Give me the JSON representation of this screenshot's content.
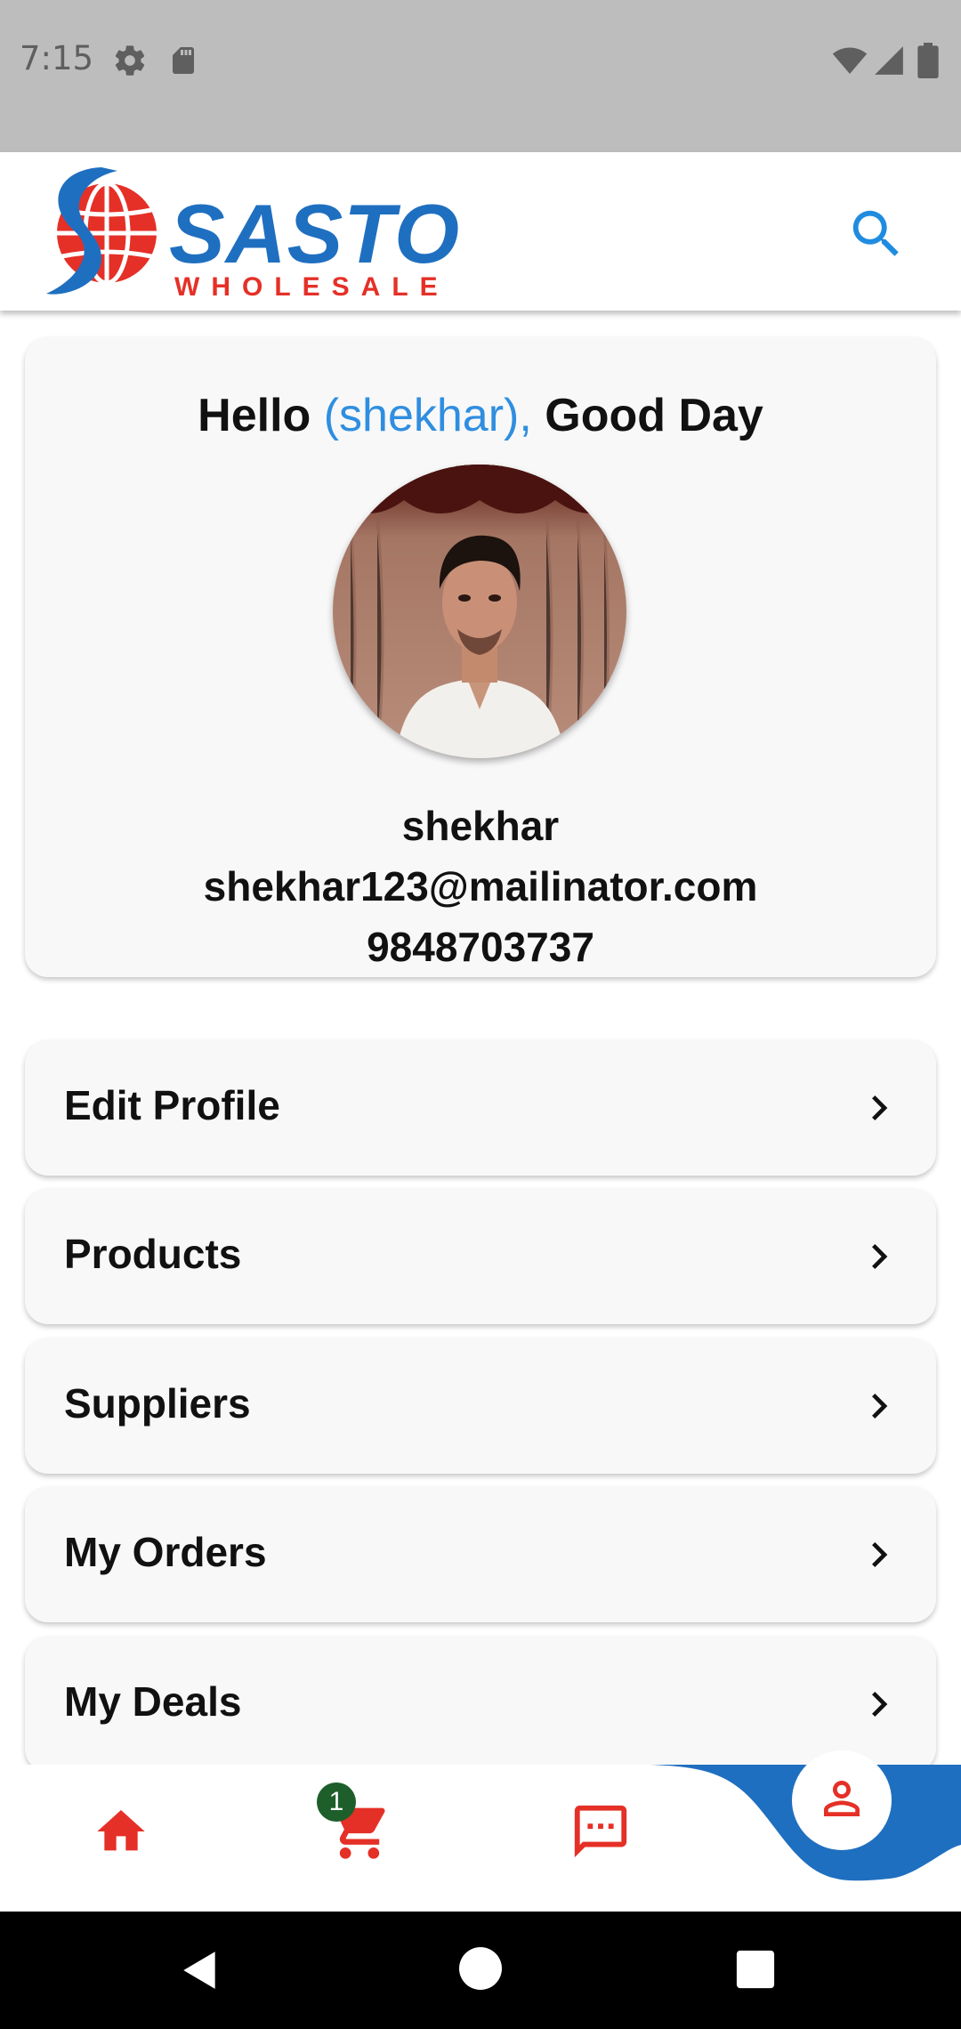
{
  "status_bar": {
    "time": "7:15",
    "left_icons": [
      "settings-icon",
      "sd-card-icon"
    ],
    "right_icons": [
      "wifi-icon",
      "signal-icon",
      "battery-icon"
    ]
  },
  "app_bar": {
    "logo_text": "SASTO",
    "logo_subtext": "WHOLESALE",
    "search_icon": "search-icon"
  },
  "profile": {
    "greeting_prefix": "Hello ",
    "greeting_name": "(shekhar),",
    "greeting_suffix": " Good Day",
    "name": "shekhar",
    "email": "shekhar123@mailinator.com",
    "phone": "9848703737"
  },
  "menu": [
    {
      "label": "Edit Profile"
    },
    {
      "label": "Products"
    },
    {
      "label": "Suppliers"
    },
    {
      "label": "My Orders"
    },
    {
      "label": "My Deals"
    }
  ],
  "bottom_nav": {
    "items": [
      "home-icon",
      "cart-icon",
      "chat-icon",
      "profile-icon"
    ],
    "cart_badge": "1",
    "active": "profile"
  },
  "colors": {
    "accent_blue": "#1f6fc0",
    "accent_red": "#e53027",
    "link_blue": "#2f8ee0",
    "badge_green": "#1e5e2a"
  }
}
